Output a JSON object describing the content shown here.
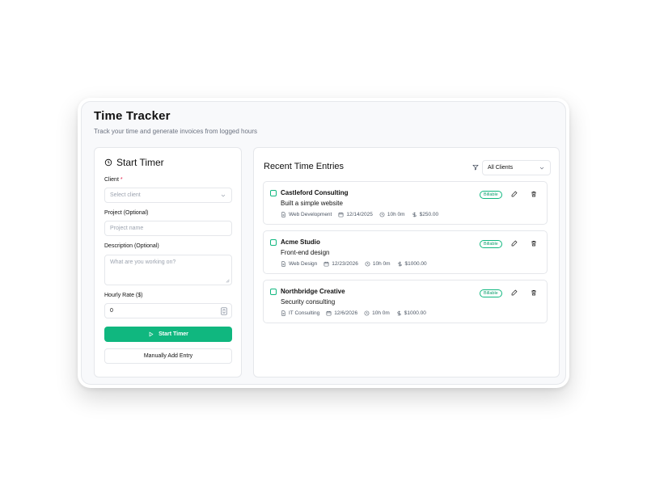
{
  "header": {
    "title": "Time Tracker",
    "subtitle": "Track your time and generate invoices from logged hours"
  },
  "timer_form": {
    "title": "Start Timer",
    "client_label": "Client",
    "client_required_mark": "*",
    "client_placeholder": "Select client",
    "project_label": "Project (Optional)",
    "project_placeholder": "Project name",
    "description_label": "Description (Optional)",
    "description_placeholder": "What are you working on?",
    "rate_label": "Hourly Rate ($)",
    "rate_value": "0",
    "start_button": "Start Timer",
    "manual_button": "Manually Add Entry"
  },
  "entries_panel": {
    "title": "Recent Time Entries",
    "filter_value": "All Clients",
    "entries": [
      {
        "client": "Castleford Consulting",
        "description": "Built a simple website",
        "category": "Web Development",
        "date": "12/14/2025",
        "duration": "10h 0m",
        "amount": "$250.00",
        "badge": "Billable"
      },
      {
        "client": "Acme Studio",
        "description": "Front-end design",
        "category": "Web Design",
        "date": "12/23/2026",
        "duration": "10h 0m",
        "amount": "$1000.00",
        "badge": "Billable"
      },
      {
        "client": "Northbridge Creative",
        "description": "Security consulting",
        "category": "IT Consulting",
        "date": "12/6/2026",
        "duration": "10h 0m",
        "amount": "$1000.00",
        "badge": "Billable"
      }
    ]
  },
  "colors": {
    "accent": "#10b77f",
    "required": "#e11d48",
    "border": "#e5e7eb"
  }
}
